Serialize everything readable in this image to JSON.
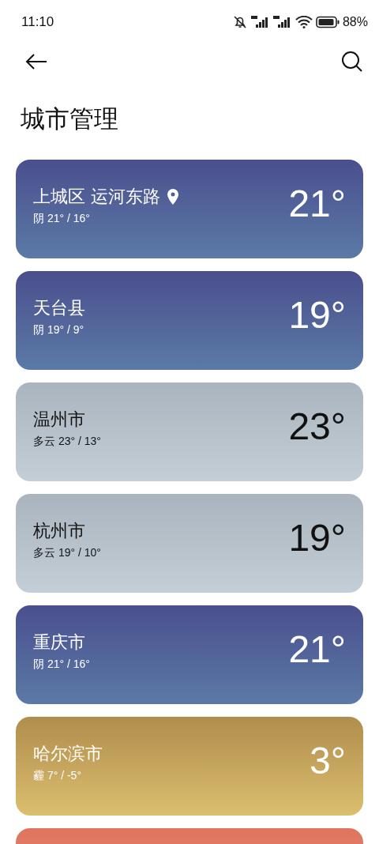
{
  "status_bar": {
    "time": "11:10",
    "battery": "88%"
  },
  "title": "城市管理",
  "cities": [
    {
      "name": "上城区 运河东路",
      "located": true,
      "summary": "阴 21° / 16°",
      "temp": "21°",
      "kind": "overcast"
    },
    {
      "name": "天台县",
      "located": false,
      "summary": "阴 19° / 9°",
      "temp": "19°",
      "kind": "overcast"
    },
    {
      "name": "温州市",
      "located": false,
      "summary": "多云 23° / 13°",
      "temp": "23°",
      "kind": "cloudy"
    },
    {
      "name": "杭州市",
      "located": false,
      "summary": "多云 19° / 10°",
      "temp": "19°",
      "kind": "cloudy"
    },
    {
      "name": "重庆市",
      "located": false,
      "summary": "阴 21° / 16°",
      "temp": "21°",
      "kind": "overcast"
    },
    {
      "name": "哈尔滨市",
      "located": false,
      "summary": "霾 7° / -5°",
      "temp": "3°",
      "kind": "haze"
    },
    {
      "kind": "sunny"
    }
  ]
}
